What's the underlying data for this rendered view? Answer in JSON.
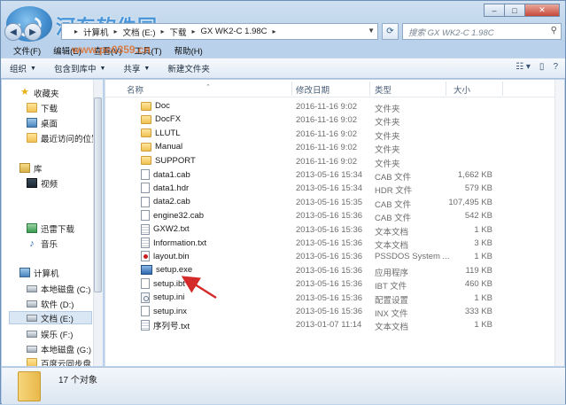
{
  "watermark": {
    "title": "河东软件园",
    "url": "www.pc0359.cn"
  },
  "window": {
    "min": "–",
    "max": "□",
    "close": "✕"
  },
  "address": {
    "crumbs": [
      "计算机",
      "文档 (E:)",
      "下载",
      "GX WK2-C 1.98C"
    ],
    "search_placeholder": "搜索 GX WK2-C 1.98C"
  },
  "menu": [
    "文件(F)",
    "编辑(E)",
    "查看(V)",
    "工具(T)",
    "帮助(H)"
  ],
  "toolbar": {
    "organize": "组织",
    "include": "包含到库中",
    "share": "共享",
    "new_folder": "新建文件夹"
  },
  "nav": {
    "favorites": "收藏夹",
    "downloads": "下载",
    "desktop": "桌面",
    "recent": "最近访问的位置",
    "libraries": "库",
    "video": "视频",
    "thunder": "迅雷下载",
    "music": "音乐",
    "computer": "计算机",
    "drive_c": "本地磁盘 (C:)",
    "drive_d": "软件 (D:)",
    "drive_e": "文档 (E:)",
    "drive_f": "娱乐 (F:)",
    "drive_g": "本地磁盘 (G:)",
    "baidu": "百度云同步盘"
  },
  "columns": {
    "name": "名称",
    "date": "修改日期",
    "type": "类型",
    "size": "大小"
  },
  "files": [
    {
      "name": "Doc",
      "date": "2016-11-16 9:02",
      "type": "文件夹",
      "size": "",
      "icon": "folder"
    },
    {
      "name": "DocFX",
      "date": "2016-11-16 9:02",
      "type": "文件夹",
      "size": "",
      "icon": "folder"
    },
    {
      "name": "LLUTL",
      "date": "2016-11-16 9:02",
      "type": "文件夹",
      "size": "",
      "icon": "folder"
    },
    {
      "name": "Manual",
      "date": "2016-11-16 9:02",
      "type": "文件夹",
      "size": "",
      "icon": "folder"
    },
    {
      "name": "SUPPORT",
      "date": "2016-11-16 9:02",
      "type": "文件夹",
      "size": "",
      "icon": "folder"
    },
    {
      "name": "data1.cab",
      "date": "2013-05-16 15:34",
      "type": "CAB 文件",
      "size": "1,662 KB",
      "icon": "doc"
    },
    {
      "name": "data1.hdr",
      "date": "2013-05-16 15:34",
      "type": "HDR 文件",
      "size": "579 KB",
      "icon": "doc"
    },
    {
      "name": "data2.cab",
      "date": "2013-05-16 15:35",
      "type": "CAB 文件",
      "size": "107,495 KB",
      "icon": "doc"
    },
    {
      "name": "engine32.cab",
      "date": "2013-05-16 15:36",
      "type": "CAB 文件",
      "size": "542 KB",
      "icon": "doc"
    },
    {
      "name": "GXW2.txt",
      "date": "2013-05-16 15:36",
      "type": "文本文档",
      "size": "1 KB",
      "icon": "txt"
    },
    {
      "name": "Information.txt",
      "date": "2013-05-16 15:36",
      "type": "文本文档",
      "size": "3 KB",
      "icon": "txt"
    },
    {
      "name": "layout.bin",
      "date": "2013-05-16 15:36",
      "type": "PSSDOS System ...",
      "size": "1 KB",
      "icon": "bin"
    },
    {
      "name": "setup.exe",
      "date": "2013-05-16 15:36",
      "type": "应用程序",
      "size": "119 KB",
      "icon": "exe"
    },
    {
      "name": "setup.ibt",
      "date": "2013-05-16 15:36",
      "type": "IBT 文件",
      "size": "460 KB",
      "icon": "doc"
    },
    {
      "name": "setup.ini",
      "date": "2013-05-16 15:36",
      "type": "配置设置",
      "size": "1 KB",
      "icon": "ini"
    },
    {
      "name": "setup.inx",
      "date": "2013-05-16 15:36",
      "type": "INX 文件",
      "size": "333 KB",
      "icon": "doc"
    },
    {
      "name": "序列号.txt",
      "date": "2013-01-07 11:14",
      "type": "文本文档",
      "size": "1 KB",
      "icon": "txt"
    }
  ],
  "status": {
    "count": "17 个对象"
  },
  "colors": {
    "accent": "#3d8fd6",
    "arrow": "#d42a2a",
    "selection": "#d9e6f4"
  }
}
